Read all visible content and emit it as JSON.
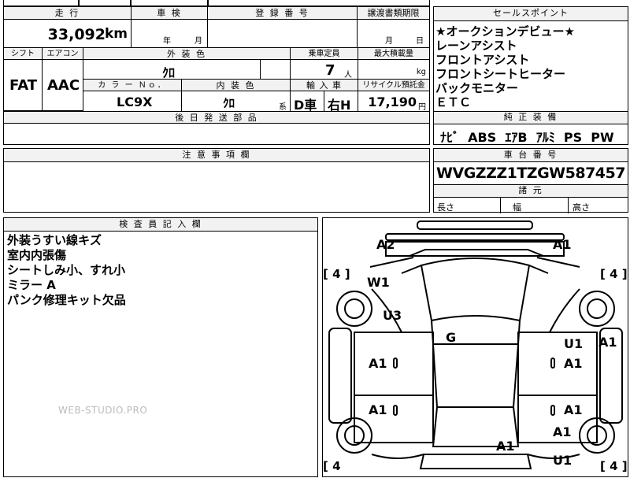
{
  "top": {
    "mileage_label": "走 行",
    "mileage_value": "33,092",
    "mileage_unit": "km",
    "inspection_label": "車 検",
    "inspection_year_unit": "年",
    "inspection_month_unit": "月",
    "registration_label": "登 録 番 号",
    "transfer_label": "譲渡書類期限",
    "transfer_month_unit": "月",
    "transfer_day_unit": "日",
    "shift_label": "シフト",
    "shift_value": "FAT",
    "ac_label": "エアコン",
    "ac_value": "AAC",
    "exterior_color_label": "外 装 色",
    "exterior_color_value": "ｸﾛ",
    "capacity_label": "乗車定員",
    "capacity_value": "7",
    "capacity_unit": "人",
    "max_load_label": "最大積載量",
    "max_load_unit": "kg",
    "color_no_label": "カ ラ ー Ｎｏ．",
    "color_no_value": "LC9X",
    "interior_color_label": "内 装 色",
    "interior_color_value": "ｸﾛ",
    "interior_color_suffix": "系",
    "import_label": "輸 入 車",
    "import_value_1": "D車",
    "import_value_2": "右H",
    "recycle_label": "リサイクル預託金",
    "recycle_value": "17,190",
    "recycle_unit": "円",
    "later_parts_label": "後 日 発 送 部 品"
  },
  "sales_points": {
    "label": "セールスポイント",
    "items": [
      "★オークションデビュー★",
      "レーンアシスト",
      "フロントアシスト",
      "フロントシートヒーター",
      "バックモニター",
      "ＥＴＣ"
    ]
  },
  "equipment": {
    "label": "純 正 装 備",
    "value": "ﾅﾋﾞ  ABS  ｴｱB  ｱﾙﾐ  PS  PW"
  },
  "notes": {
    "label": "注 意 事 項 欄"
  },
  "chassis": {
    "label": "車 台 番 号",
    "value": "WVGZZZ1TZGW587457"
  },
  "dimensions": {
    "label": "諸 元",
    "length_label": "長さ",
    "width_label": "幅",
    "height_label": "高さ"
  },
  "inspector": {
    "label": "検 査 員 記 入 欄",
    "lines": [
      "外装うすい線キズ",
      "室内内張傷",
      "シートしみ小、すれ小",
      "ミラー A",
      "パンク修理キット欠品"
    ]
  },
  "diagram_marks": {
    "a2_front_left": "A2",
    "a1_front_right": "A1",
    "w1": "W1",
    "u3": "U3",
    "g": "G",
    "u1_right_upper": "U1",
    "a1_right_edge": "A1",
    "a1_left_door_front": "A1",
    "a1_right_door_front": "A1",
    "a1_left_door_rear": "A1",
    "a1_right_door_rear": "A1",
    "a1_right_rear_upper": "A1",
    "a1_rear": "A1",
    "u1_rear": "U1",
    "tire_fl": "[ 4 ]",
    "tire_fr": "[ 4 ]",
    "tire_rl": "[ 4",
    "tire_rr": "[ 4 ]"
  },
  "watermark": "WEB-STUDIO.PRO"
}
